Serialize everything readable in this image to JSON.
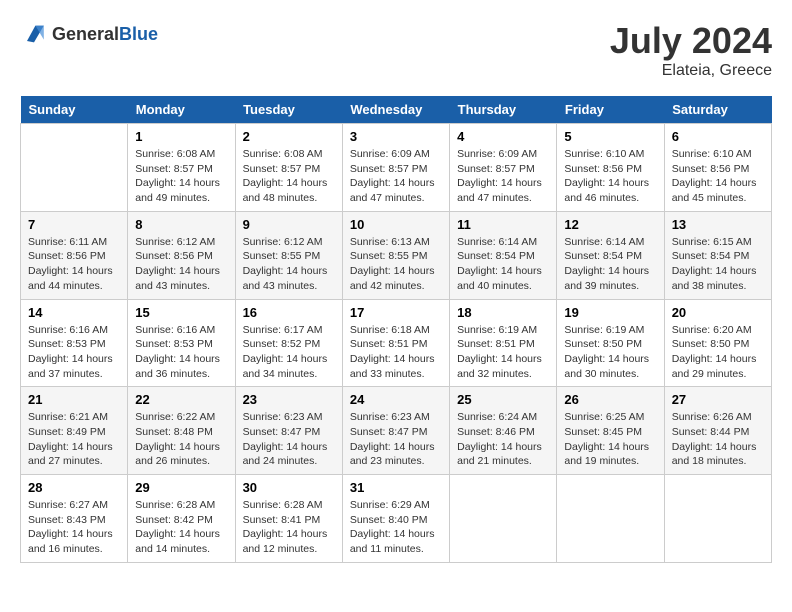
{
  "header": {
    "logo_general": "General",
    "logo_blue": "Blue",
    "month_year": "July 2024",
    "location": "Elateia, Greece"
  },
  "days_of_week": [
    "Sunday",
    "Monday",
    "Tuesday",
    "Wednesday",
    "Thursday",
    "Friday",
    "Saturday"
  ],
  "weeks": [
    [
      {
        "day": "",
        "sunrise": "",
        "sunset": "",
        "daylight": ""
      },
      {
        "day": "1",
        "sunrise": "Sunrise: 6:08 AM",
        "sunset": "Sunset: 8:57 PM",
        "daylight": "Daylight: 14 hours and 49 minutes."
      },
      {
        "day": "2",
        "sunrise": "Sunrise: 6:08 AM",
        "sunset": "Sunset: 8:57 PM",
        "daylight": "Daylight: 14 hours and 48 minutes."
      },
      {
        "day": "3",
        "sunrise": "Sunrise: 6:09 AM",
        "sunset": "Sunset: 8:57 PM",
        "daylight": "Daylight: 14 hours and 47 minutes."
      },
      {
        "day": "4",
        "sunrise": "Sunrise: 6:09 AM",
        "sunset": "Sunset: 8:57 PM",
        "daylight": "Daylight: 14 hours and 47 minutes."
      },
      {
        "day": "5",
        "sunrise": "Sunrise: 6:10 AM",
        "sunset": "Sunset: 8:56 PM",
        "daylight": "Daylight: 14 hours and 46 minutes."
      },
      {
        "day": "6",
        "sunrise": "Sunrise: 6:10 AM",
        "sunset": "Sunset: 8:56 PM",
        "daylight": "Daylight: 14 hours and 45 minutes."
      }
    ],
    [
      {
        "day": "7",
        "sunrise": "Sunrise: 6:11 AM",
        "sunset": "Sunset: 8:56 PM",
        "daylight": "Daylight: 14 hours and 44 minutes."
      },
      {
        "day": "8",
        "sunrise": "Sunrise: 6:12 AM",
        "sunset": "Sunset: 8:56 PM",
        "daylight": "Daylight: 14 hours and 43 minutes."
      },
      {
        "day": "9",
        "sunrise": "Sunrise: 6:12 AM",
        "sunset": "Sunset: 8:55 PM",
        "daylight": "Daylight: 14 hours and 43 minutes."
      },
      {
        "day": "10",
        "sunrise": "Sunrise: 6:13 AM",
        "sunset": "Sunset: 8:55 PM",
        "daylight": "Daylight: 14 hours and 42 minutes."
      },
      {
        "day": "11",
        "sunrise": "Sunrise: 6:14 AM",
        "sunset": "Sunset: 8:54 PM",
        "daylight": "Daylight: 14 hours and 40 minutes."
      },
      {
        "day": "12",
        "sunrise": "Sunrise: 6:14 AM",
        "sunset": "Sunset: 8:54 PM",
        "daylight": "Daylight: 14 hours and 39 minutes."
      },
      {
        "day": "13",
        "sunrise": "Sunrise: 6:15 AM",
        "sunset": "Sunset: 8:54 PM",
        "daylight": "Daylight: 14 hours and 38 minutes."
      }
    ],
    [
      {
        "day": "14",
        "sunrise": "Sunrise: 6:16 AM",
        "sunset": "Sunset: 8:53 PM",
        "daylight": "Daylight: 14 hours and 37 minutes."
      },
      {
        "day": "15",
        "sunrise": "Sunrise: 6:16 AM",
        "sunset": "Sunset: 8:53 PM",
        "daylight": "Daylight: 14 hours and 36 minutes."
      },
      {
        "day": "16",
        "sunrise": "Sunrise: 6:17 AM",
        "sunset": "Sunset: 8:52 PM",
        "daylight": "Daylight: 14 hours and 34 minutes."
      },
      {
        "day": "17",
        "sunrise": "Sunrise: 6:18 AM",
        "sunset": "Sunset: 8:51 PM",
        "daylight": "Daylight: 14 hours and 33 minutes."
      },
      {
        "day": "18",
        "sunrise": "Sunrise: 6:19 AM",
        "sunset": "Sunset: 8:51 PM",
        "daylight": "Daylight: 14 hours and 32 minutes."
      },
      {
        "day": "19",
        "sunrise": "Sunrise: 6:19 AM",
        "sunset": "Sunset: 8:50 PM",
        "daylight": "Daylight: 14 hours and 30 minutes."
      },
      {
        "day": "20",
        "sunrise": "Sunrise: 6:20 AM",
        "sunset": "Sunset: 8:50 PM",
        "daylight": "Daylight: 14 hours and 29 minutes."
      }
    ],
    [
      {
        "day": "21",
        "sunrise": "Sunrise: 6:21 AM",
        "sunset": "Sunset: 8:49 PM",
        "daylight": "Daylight: 14 hours and 27 minutes."
      },
      {
        "day": "22",
        "sunrise": "Sunrise: 6:22 AM",
        "sunset": "Sunset: 8:48 PM",
        "daylight": "Daylight: 14 hours and 26 minutes."
      },
      {
        "day": "23",
        "sunrise": "Sunrise: 6:23 AM",
        "sunset": "Sunset: 8:47 PM",
        "daylight": "Daylight: 14 hours and 24 minutes."
      },
      {
        "day": "24",
        "sunrise": "Sunrise: 6:23 AM",
        "sunset": "Sunset: 8:47 PM",
        "daylight": "Daylight: 14 hours and 23 minutes."
      },
      {
        "day": "25",
        "sunrise": "Sunrise: 6:24 AM",
        "sunset": "Sunset: 8:46 PM",
        "daylight": "Daylight: 14 hours and 21 minutes."
      },
      {
        "day": "26",
        "sunrise": "Sunrise: 6:25 AM",
        "sunset": "Sunset: 8:45 PM",
        "daylight": "Daylight: 14 hours and 19 minutes."
      },
      {
        "day": "27",
        "sunrise": "Sunrise: 6:26 AM",
        "sunset": "Sunset: 8:44 PM",
        "daylight": "Daylight: 14 hours and 18 minutes."
      }
    ],
    [
      {
        "day": "28",
        "sunrise": "Sunrise: 6:27 AM",
        "sunset": "Sunset: 8:43 PM",
        "daylight": "Daylight: 14 hours and 16 minutes."
      },
      {
        "day": "29",
        "sunrise": "Sunrise: 6:28 AM",
        "sunset": "Sunset: 8:42 PM",
        "daylight": "Daylight: 14 hours and 14 minutes."
      },
      {
        "day": "30",
        "sunrise": "Sunrise: 6:28 AM",
        "sunset": "Sunset: 8:41 PM",
        "daylight": "Daylight: 14 hours and 12 minutes."
      },
      {
        "day": "31",
        "sunrise": "Sunrise: 6:29 AM",
        "sunset": "Sunset: 8:40 PM",
        "daylight": "Daylight: 14 hours and 11 minutes."
      },
      {
        "day": "",
        "sunrise": "",
        "sunset": "",
        "daylight": ""
      },
      {
        "day": "",
        "sunrise": "",
        "sunset": "",
        "daylight": ""
      },
      {
        "day": "",
        "sunrise": "",
        "sunset": "",
        "daylight": ""
      }
    ]
  ]
}
